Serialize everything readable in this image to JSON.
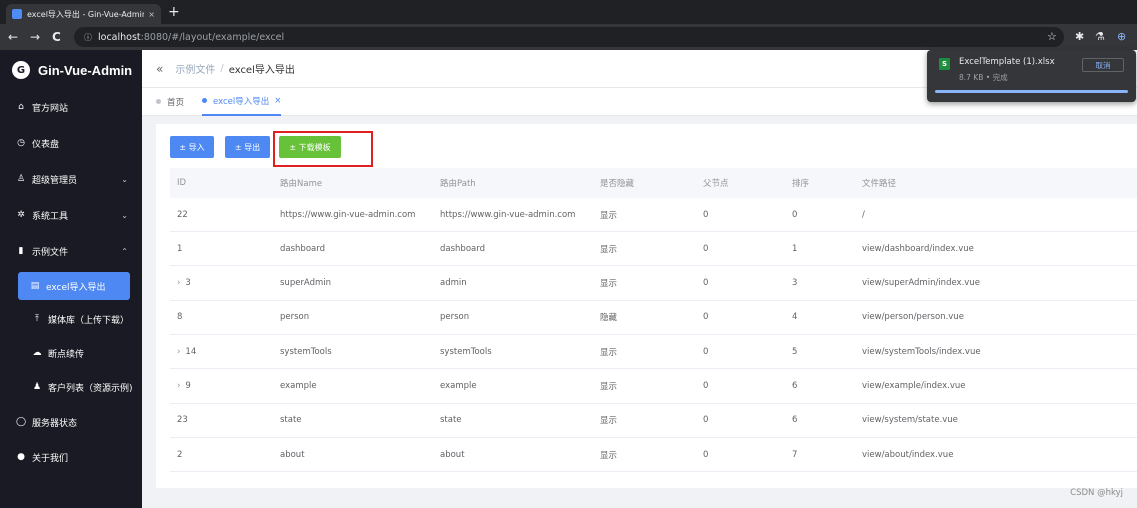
{
  "browser": {
    "tab_title": "excel导入导出 - Gin-Vue-Admin",
    "tab_close": "×",
    "new_tab": "+",
    "url_host": "localhost",
    "url_path": ":8080/#/layout/example/excel",
    "info_glyph": "ⓘ",
    "back": "←",
    "forward": "→",
    "reload": "C",
    "star": "☆",
    "puzzle": "✱",
    "flask": "⚗",
    "download": "⊕"
  },
  "sidebar": {
    "brand": "Gin-Vue-Admin",
    "logo": "G",
    "items": [
      {
        "label": "官方网站",
        "icon": "⌂",
        "chev": ""
      },
      {
        "label": "仪表盘",
        "icon": "◷",
        "chev": ""
      },
      {
        "label": "超级管理员",
        "icon": "♙",
        "chev": "⌄"
      },
      {
        "label": "系统工具",
        "icon": "✲",
        "chev": "⌄"
      },
      {
        "label": "示例文件",
        "icon": "▮",
        "chev": "⌃"
      },
      {
        "label": "excel导入导出",
        "icon": "▤",
        "chev": ""
      },
      {
        "label": "媒体库（上传下载）",
        "icon": "⤒",
        "chev": ""
      },
      {
        "label": "断点续传",
        "icon": "☁",
        "chev": ""
      },
      {
        "label": "客户列表（资源示例)",
        "icon": "♟",
        "chev": ""
      },
      {
        "label": "服务器状态",
        "icon": "◯",
        "chev": ""
      },
      {
        "label": "关于我们",
        "icon": "●",
        "chev": ""
      }
    ]
  },
  "header": {
    "collapse": "«",
    "crumb1": "示例文件",
    "sep": "/",
    "crumb2": "excel导入导出"
  },
  "tags": [
    {
      "label": "首页",
      "close": ""
    },
    {
      "label": "excel导入导出",
      "close": "×"
    }
  ],
  "toolbar": {
    "import": "± 导入",
    "export": "± 导出",
    "template": "± 下载模板"
  },
  "table": {
    "headers": [
      "ID",
      "路由Name",
      "路由Path",
      "是否隐藏",
      "父节点",
      "排序",
      "文件路径"
    ],
    "rows": [
      {
        "id": "22",
        "exp": "",
        "name": "https://www.gin-vue-admin.com",
        "path": "https://www.gin-vue-admin.com",
        "hidden": "显示",
        "parent": "0",
        "sort": "0",
        "file": "/"
      },
      {
        "id": "1",
        "exp": "",
        "name": "dashboard",
        "path": "dashboard",
        "hidden": "显示",
        "parent": "0",
        "sort": "1",
        "file": "view/dashboard/index.vue"
      },
      {
        "id": "3",
        "exp": "›",
        "name": "superAdmin",
        "path": "admin",
        "hidden": "显示",
        "parent": "0",
        "sort": "3",
        "file": "view/superAdmin/index.vue"
      },
      {
        "id": "8",
        "exp": "",
        "name": "person",
        "path": "person",
        "hidden": "隐藏",
        "parent": "0",
        "sort": "4",
        "file": "view/person/person.vue"
      },
      {
        "id": "14",
        "exp": "›",
        "name": "systemTools",
        "path": "systemTools",
        "hidden": "显示",
        "parent": "0",
        "sort": "5",
        "file": "view/systemTools/index.vue"
      },
      {
        "id": "9",
        "exp": "›",
        "name": "example",
        "path": "example",
        "hidden": "显示",
        "parent": "0",
        "sort": "6",
        "file": "view/example/index.vue"
      },
      {
        "id": "23",
        "exp": "",
        "name": "state",
        "path": "state",
        "hidden": "显示",
        "parent": "0",
        "sort": "6",
        "file": "view/system/state.vue"
      },
      {
        "id": "2",
        "exp": "",
        "name": "about",
        "path": "about",
        "hidden": "显示",
        "parent": "0",
        "sort": "7",
        "file": "view/about/index.vue"
      }
    ]
  },
  "download": {
    "icon": "S",
    "filename": "ExcelTemplate (1).xlsx",
    "meta": "8.7 KB • 完成",
    "cancel": "取消",
    "progress": 1.0
  },
  "watermark": "CSDN @hkyj",
  "colors": {
    "primary": "#4e88f3",
    "success": "#67c23a",
    "sidebar_bg": "#191a23",
    "highlight": "#e02020"
  }
}
